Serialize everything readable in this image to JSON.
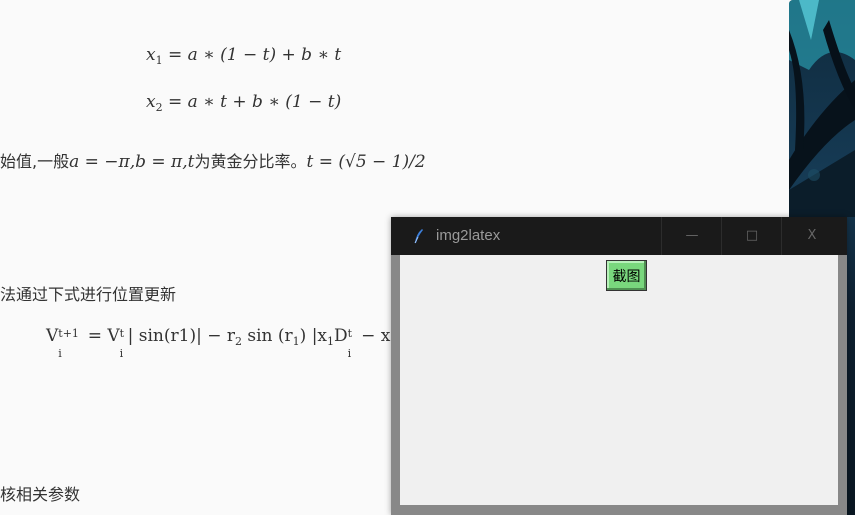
{
  "document": {
    "eq1": {
      "lhs_var": "x",
      "lhs_sub": "1",
      "rhs": "= a ∗ (1 − t) + b ∗ t"
    },
    "eq2": {
      "lhs_var": "x",
      "lhs_sub": "2",
      "rhs": "= a ∗ t + b ∗ (1 − t)"
    },
    "line3_cn1": "始值,一般",
    "line3_math1": "a = −π,b = π,t",
    "line3_cn2": "为黄金分比率。",
    "line3_math2": "t = (√5 − 1)/2",
    "line4_cn": "法通过下式进行位置更新",
    "eq3": {
      "v": "V",
      "sup1": "t+1",
      "sub1": "i",
      "mid": "= V",
      "sup2": "t",
      "sub2": "i",
      "rest": "| sin(r1)| − r",
      "sub3": "2",
      "rest2": " sin (r",
      "sub4": "1",
      "rest3": ") |x",
      "sub5": "1",
      "rest4": "D",
      "sup6": "t",
      "sub6": "i",
      "rest5": " − x"
    },
    "line6_cn": "核相关参数"
  },
  "window": {
    "title": "img2latex",
    "minimize_glyph": "—",
    "maximize_glyph": "□",
    "close_glyph": "X",
    "capture_label": "截图"
  },
  "colors": {
    "button_green": "#79d77d",
    "titlebar": "#1a1a1a",
    "client_bg": "#f0f0f0"
  }
}
